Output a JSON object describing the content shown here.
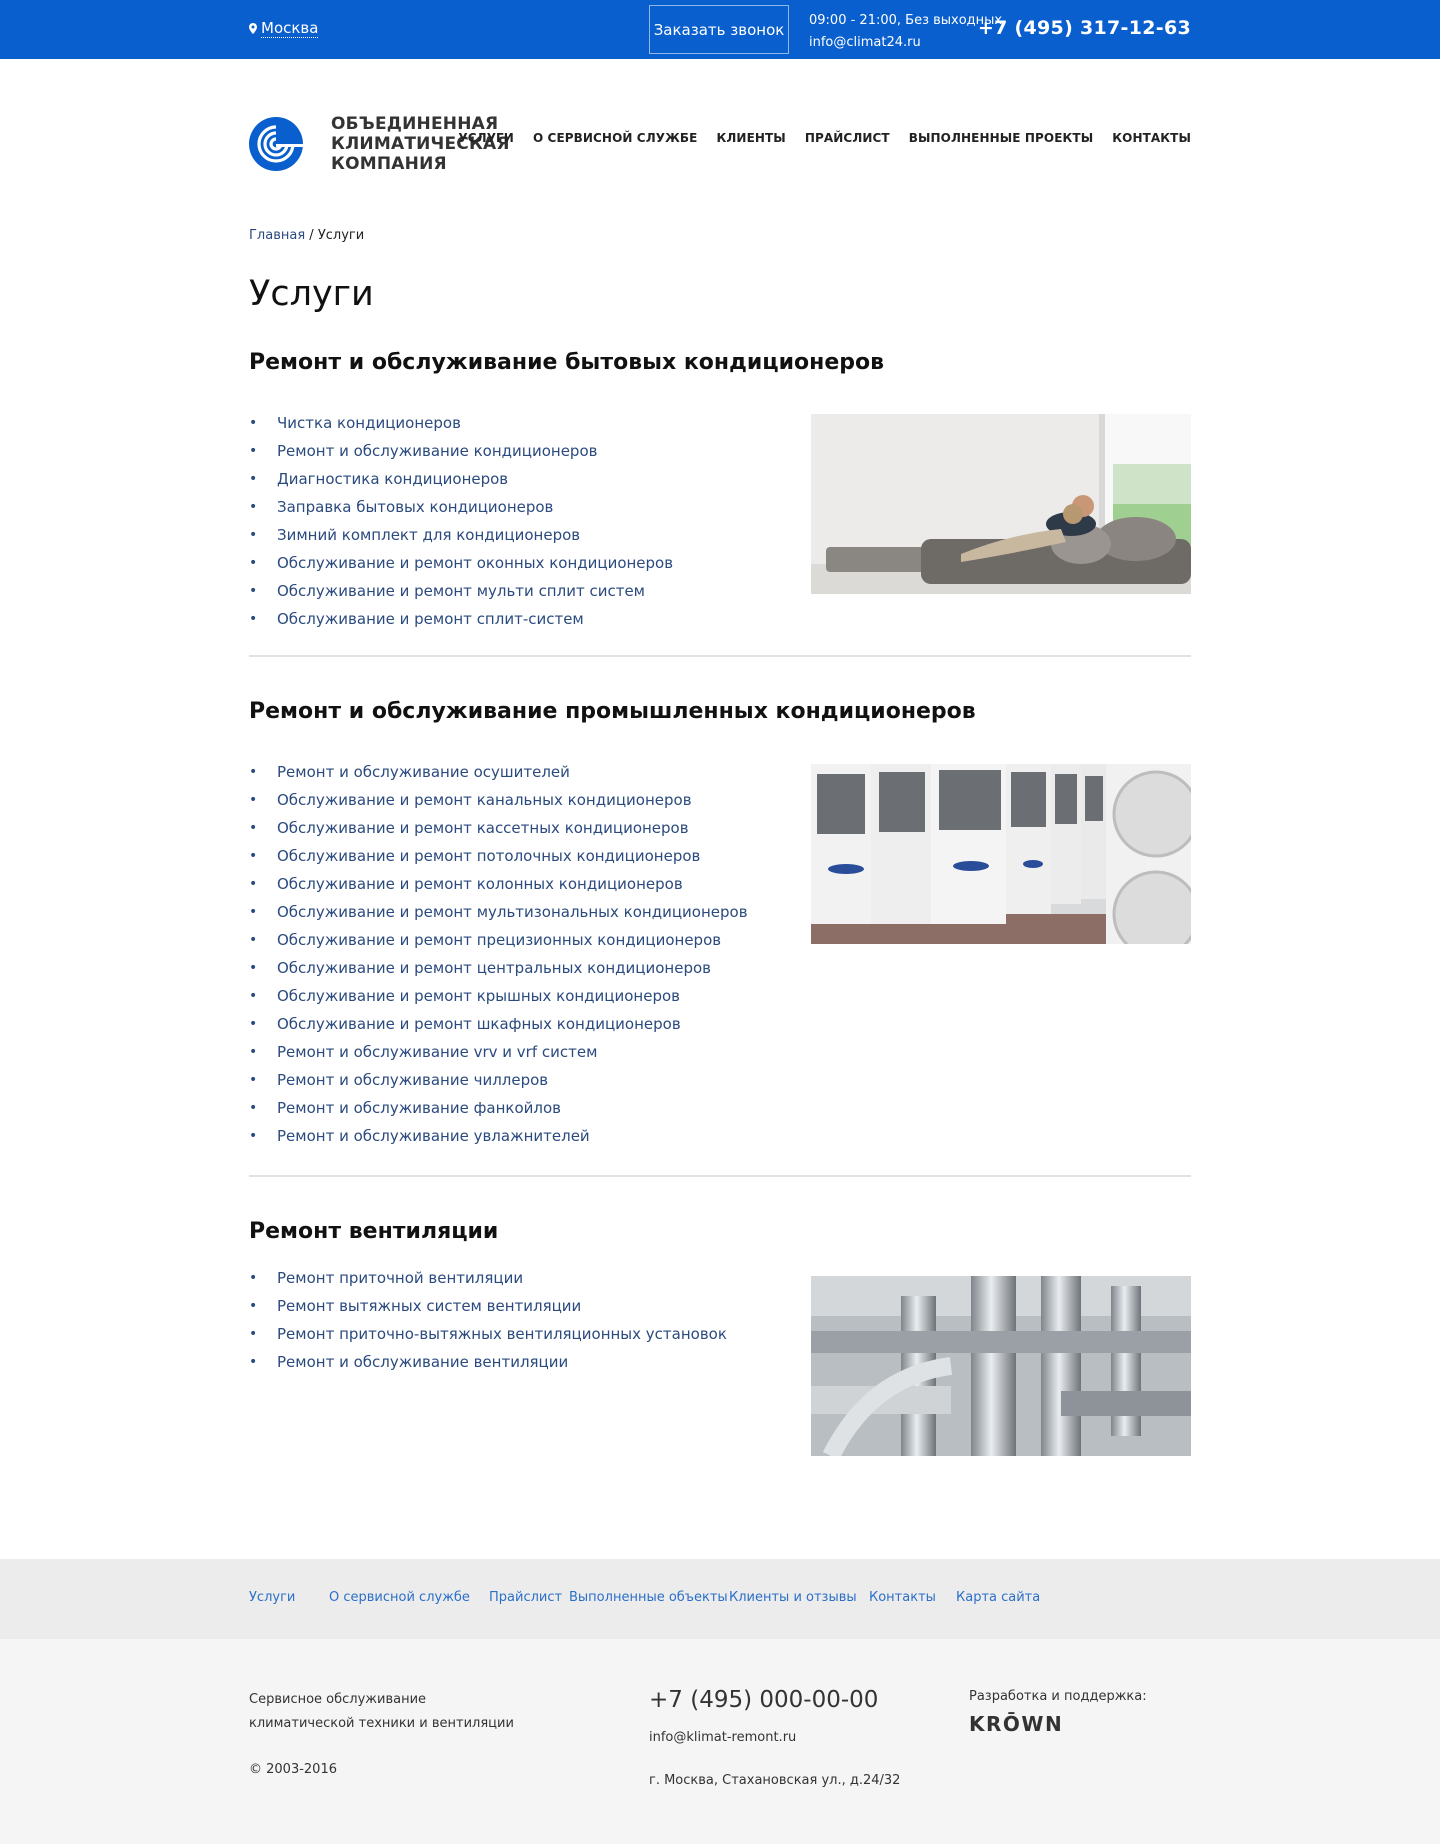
{
  "topbar": {
    "city": "Москва",
    "callback_label": "Заказать звонок",
    "hours": "09:00 - 21:00, Без выходных",
    "email": "info@climat24.ru",
    "phone": "+7 (495) 317-12-63"
  },
  "logo": {
    "line1": "ОБЪЕДИНЕННАЯ",
    "line2": "КЛИМАТИЧЕСКАЯ",
    "line3": "КОМПАНИЯ"
  },
  "nav": [
    "УСЛУГИ",
    "О СЕРВИСНОЙ СЛУЖБЕ",
    "КЛИЕНТЫ",
    "ПРАЙСЛИСТ",
    "ВЫПОЛНЕННЫЕ ПРОЕКТЫ",
    "КОНТАКТЫ"
  ],
  "breadcrumb": {
    "home": "Главная",
    "separator": "/",
    "current": "Услуги"
  },
  "page_title": "Услуги",
  "sections": [
    {
      "title": "Ремонт и обслуживание бытовых кондиционеров",
      "items": [
        "Чистка кондиционеров",
        "Ремонт и обслуживание кондиционеров",
        "Диагностика кондиционеров",
        "Заправка бытовых кондиционеров",
        "Зимний комплект для кондиционеров",
        "Обслуживание и ремонт оконных кондиционеров",
        "Обслуживание и ремонт мульти сплит систем",
        "Обслуживание и ремонт сплит-систем"
      ]
    },
    {
      "title": "Ремонт и обслуживание промышленных кондиционеров",
      "items": [
        "Ремонт и обслуживание осушителей",
        "Обслуживание и ремонт канальных кондиционеров",
        "Обслуживание и ремонт кассетных кондиционеров",
        "Обслуживание и ремонт потолочных кондиционеров",
        "Обслуживание и ремонт колонных кондиционеров",
        "Обслуживание и ремонт мультизональных кондиционеров",
        "Обслуживание и ремонт прецизионных кондиционеров",
        "Обслуживание и ремонт центральных кондиционеров",
        "Обслуживание и ремонт крышных кондиционеров",
        "Обслуживание и ремонт шкафных кондиционеров",
        "Ремонт и обслуживание vrv и vrf систем",
        "Ремонт и обслуживание чиллеров",
        "Ремонт и обслуживание фанкойлов",
        "Ремонт и обслуживание увлажнителей"
      ]
    },
    {
      "title": "Ремонт вентиляции",
      "items": [
        "Ремонт приточной вентиляции",
        "Ремонт вытяжных систем вентиляции",
        "Ремонт приточно-вытяжных вентиляционных установок",
        "Ремонт и обслуживание вентиляции"
      ]
    }
  ],
  "footer_nav": [
    "Услуги",
    "О сервисной службе",
    "Прайслист",
    "Выполненные объекты",
    "Клиенты и отзывы",
    "Контакты",
    "Карта сайта"
  ],
  "footer": {
    "description": "Сервисное обслуживание климатической техники и вентиляции",
    "copyright": "© 2003-2016",
    "phone": "+7 (495) 000-00-00",
    "email": "info@klimat-remont.ru",
    "address": "г. Москва, Стахановская ул., д.24/32",
    "developer_label": "Разработка и поддержка:",
    "developer_brand": "KRŌWN"
  },
  "colors": {
    "brand_blue": "#0a5fce",
    "link": "#2b4a7e",
    "footer_link": "#2b6fc9"
  }
}
